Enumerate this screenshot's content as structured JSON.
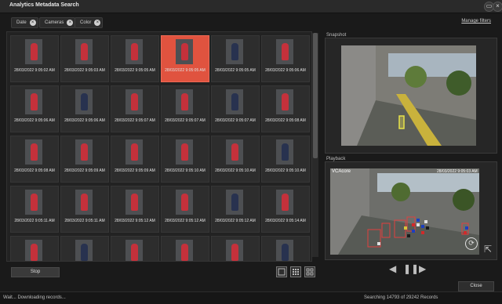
{
  "window": {
    "title": "Analytics Metadata Search"
  },
  "filters": {
    "chips": [
      "Date",
      "Cameras",
      "Color"
    ],
    "manage_label": "Manage filters"
  },
  "results": {
    "rows": [
      [
        "28/03/2022 9:05:02 AM",
        "28/03/2022 9:05:03 AM",
        "28/03/2022 9:05:05 AM",
        "28/03/2022 9:05:05 AM",
        "28/03/2022 9:05:05 AM",
        "28/03/2022 9:05:06 AM"
      ],
      [
        "28/03/2022 9:05:06 AM",
        "28/03/2022 9:05:06 AM",
        "28/03/2022 9:05:07 AM",
        "28/03/2022 9:05:07 AM",
        "28/03/2022 9:05:07 AM",
        "28/03/2022 9:05:08 AM"
      ],
      [
        "28/03/2022 9:05:08 AM",
        "28/03/2022 9:05:09 AM",
        "28/03/2022 9:05:09 AM",
        "28/03/2022 9:05:10 AM",
        "28/03/2022 9:05:10 AM",
        "28/03/2022 9:05:10 AM"
      ],
      [
        "28/03/2022 9:05:11 AM",
        "28/03/2022 9:05:11 AM",
        "28/03/2022 9:05:12 AM",
        "28/03/2022 9:05:12 AM",
        "28/03/2022 9:05:12 AM",
        "28/03/2022 9:05:14 AM"
      ],
      [
        "",
        "",
        "",
        "",
        "",
        ""
      ]
    ],
    "selected": [
      0,
      3
    ]
  },
  "snapshot": {
    "label": "Snapshot"
  },
  "playback": {
    "label": "Playback",
    "camera_name": "VCAcore",
    "timestamp_overlay": "28/03/2022 9:05:03 AM"
  },
  "controls": {
    "stop_label": "Stop",
    "close_label": "Close"
  },
  "status": {
    "left": "Wait... Downloading records...",
    "right": "Searching 14793 of 29242 Records"
  },
  "colors": {
    "accent_selected": "#e0533f",
    "person_red": "#c4313b",
    "person_navy": "#28324f"
  }
}
